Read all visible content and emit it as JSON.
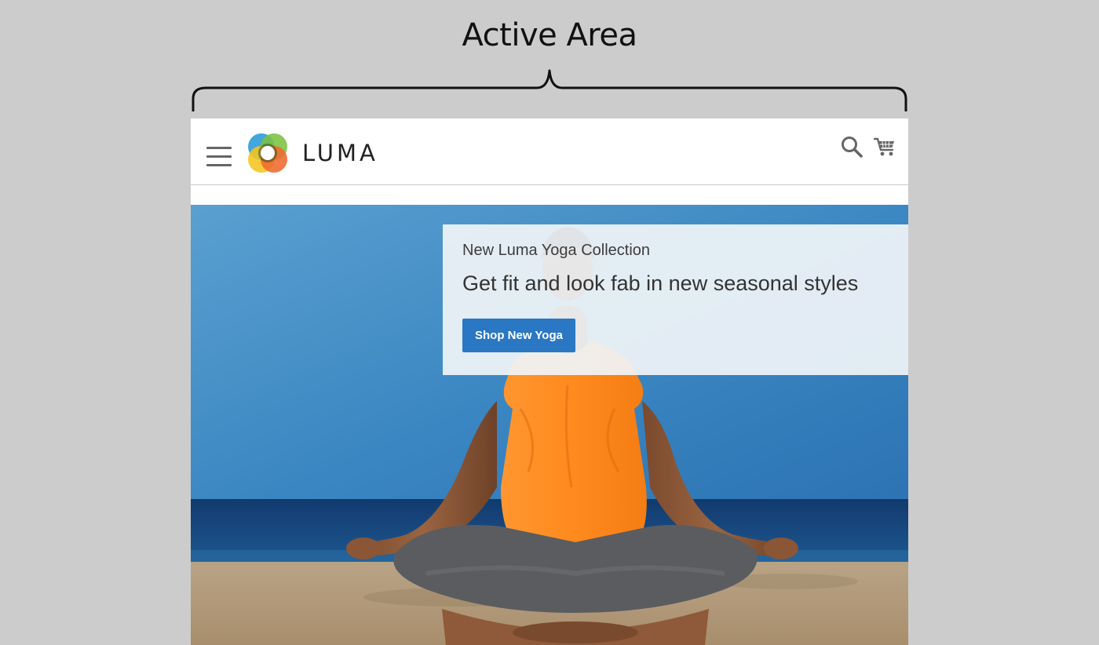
{
  "annotation": {
    "title": "Active Area"
  },
  "header": {
    "logo_text": "LUMA",
    "menu_icon": "hamburger-menu-icon",
    "search_icon": "search-icon",
    "cart_icon": "shopping-cart-icon"
  },
  "hero": {
    "kicker": "New Luma Yoga Collection",
    "headline": "Get fit and look fab in new seasonal styles",
    "cta_label": "Shop New Yoga"
  },
  "colors": {
    "page_background": "#cccccc",
    "cta_background": "#2a77c3",
    "sky": "#3b8ac4",
    "sea": "#123f78",
    "sand": "#b79f7f",
    "top_orange": "#ff8a1e"
  }
}
